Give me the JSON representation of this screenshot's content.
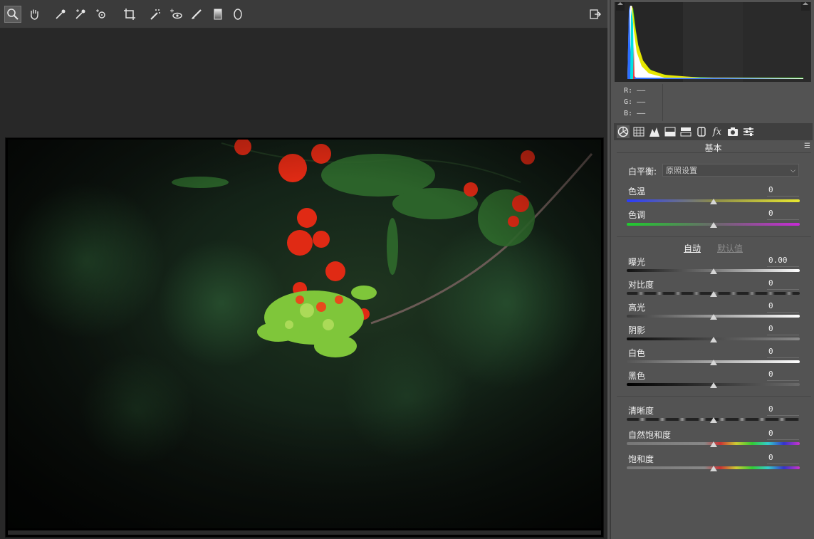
{
  "toolbar": {
    "tools": [
      {
        "name": "zoom-tool",
        "icon": "magnifier-icon"
      },
      {
        "name": "hand-tool",
        "icon": "hand-icon"
      },
      {
        "name": "white-balance-tool",
        "icon": "eyedropper-icon"
      },
      {
        "name": "color-sampler-tool",
        "icon": "eyedropper-plus-icon"
      },
      {
        "name": "targeted-adjustment-tool",
        "icon": "target-icon"
      },
      {
        "name": "crop-tool",
        "icon": "crop-icon"
      },
      {
        "name": "spot-removal-tool",
        "icon": "spot-brush-icon"
      },
      {
        "name": "red-eye-tool",
        "icon": "eye-icon"
      },
      {
        "name": "adjustment-brush-tool",
        "icon": "brush-icon"
      },
      {
        "name": "graduated-filter-tool",
        "icon": "gradient-icon"
      },
      {
        "name": "radial-filter-tool",
        "icon": "ellipse-icon"
      }
    ],
    "open_panel_icon": "export-icon"
  },
  "histogram": {
    "r_label": "R:",
    "g_label": "G:",
    "b_label": "B:",
    "r_value": "——",
    "g_value": "——",
    "b_value": "——"
  },
  "panel_tabs": [
    "basic-icon",
    "tone-curve-icon",
    "detail-icon",
    "hsl-icon",
    "split-toning-icon",
    "lens-icon",
    "fx-icon",
    "camera-calibration-icon",
    "presets-icon"
  ],
  "panel": {
    "title": "基本",
    "white_balance_label": "白平衡:",
    "white_balance_value": "原照设置",
    "temp": {
      "label": "色温",
      "value": "0",
      "level": 0.5
    },
    "tint": {
      "label": "色调",
      "value": "0",
      "level": 0.5
    },
    "auto_label": "自动",
    "default_label": "默认值",
    "exposure": {
      "label": "曝光",
      "value": "0.00",
      "level": 0.5
    },
    "contrast": {
      "label": "对比度",
      "value": "0",
      "level": 0.5
    },
    "highlights": {
      "label": "高光",
      "value": "0",
      "level": 0.5
    },
    "shadows": {
      "label": "阴影",
      "value": "0",
      "level": 0.5
    },
    "whites": {
      "label": "白色",
      "value": "0",
      "level": 0.5
    },
    "blacks": {
      "label": "黑色",
      "value": "0",
      "level": 0.5
    },
    "clarity": {
      "label": "清晰度",
      "value": "0",
      "level": 0.5
    },
    "vibrance": {
      "label": "自然饱和度",
      "value": "0",
      "level": 0.5
    },
    "saturation": {
      "label": "饱和度",
      "value": "0",
      "level": 0.5
    }
  },
  "colors": {
    "accent_flower": "#e02a14",
    "foliage": "#7fc63a"
  }
}
